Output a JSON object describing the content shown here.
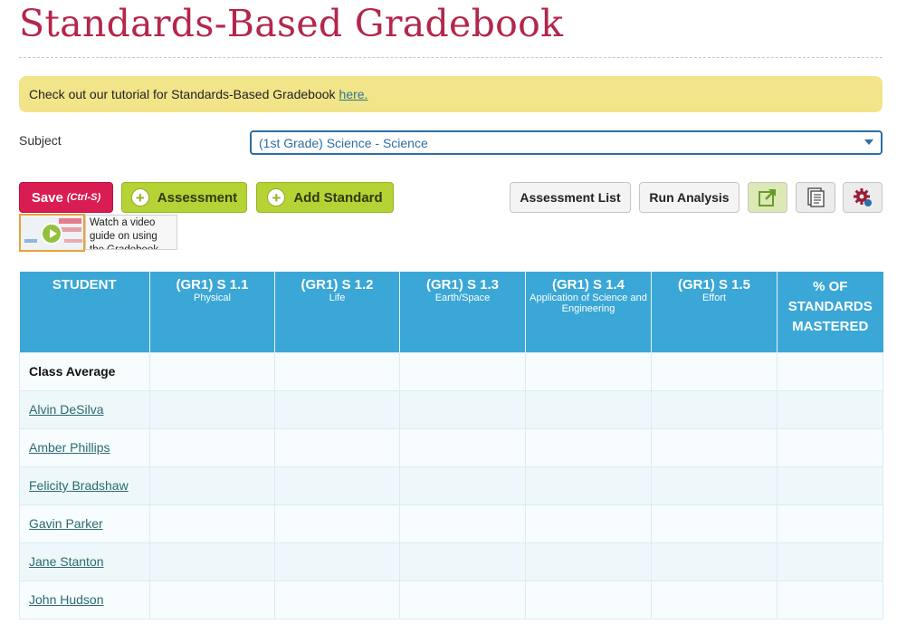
{
  "page": {
    "title": "Standards-Based Gradebook"
  },
  "notice": {
    "text": "Check out our tutorial for Standards-Based Gradebook",
    "link_label": "here."
  },
  "subject": {
    "label": "Subject",
    "selected": "(1st Grade) Science - Science"
  },
  "toolbar": {
    "save_label": "Save",
    "save_hint": "(Ctrl-S)",
    "assessment_label": "Assessment",
    "add_standard_label": "Add Standard",
    "assessment_list_label": "Assessment List",
    "run_analysis_label": "Run Analysis",
    "icons": [
      "export-icon",
      "document-icon",
      "gear-icon"
    ]
  },
  "video_guide": {
    "caption": "Watch a video guide on using the Gradebook"
  },
  "table": {
    "student_header": "STUDENT",
    "standards": [
      {
        "code": "(GR1) S 1.1",
        "name": "Physical"
      },
      {
        "code": "(GR1) S 1.2",
        "name": "Life"
      },
      {
        "code": "(GR1) S 1.3",
        "name": "Earth/Space"
      },
      {
        "code": "(GR1) S 1.4",
        "name": "Application of Science and Engineering"
      },
      {
        "code": "(GR1) S 1.5",
        "name": "Effort"
      }
    ],
    "percent_header": "% OF STANDARDS MASTERED",
    "class_average_label": "Class Average",
    "students": [
      "Alvin DeSilva",
      "Amber Phillips",
      "Felicity Bradshaw",
      "Gavin Parker",
      "Jane Stanton",
      "John Hudson"
    ]
  },
  "colors": {
    "title": "#b4264a",
    "notice_bg": "#f2e489",
    "save_bg": "#d91c52",
    "green_btn": "#b5d334",
    "table_header": "#3aa7d6",
    "link": "#2a6b6f"
  }
}
